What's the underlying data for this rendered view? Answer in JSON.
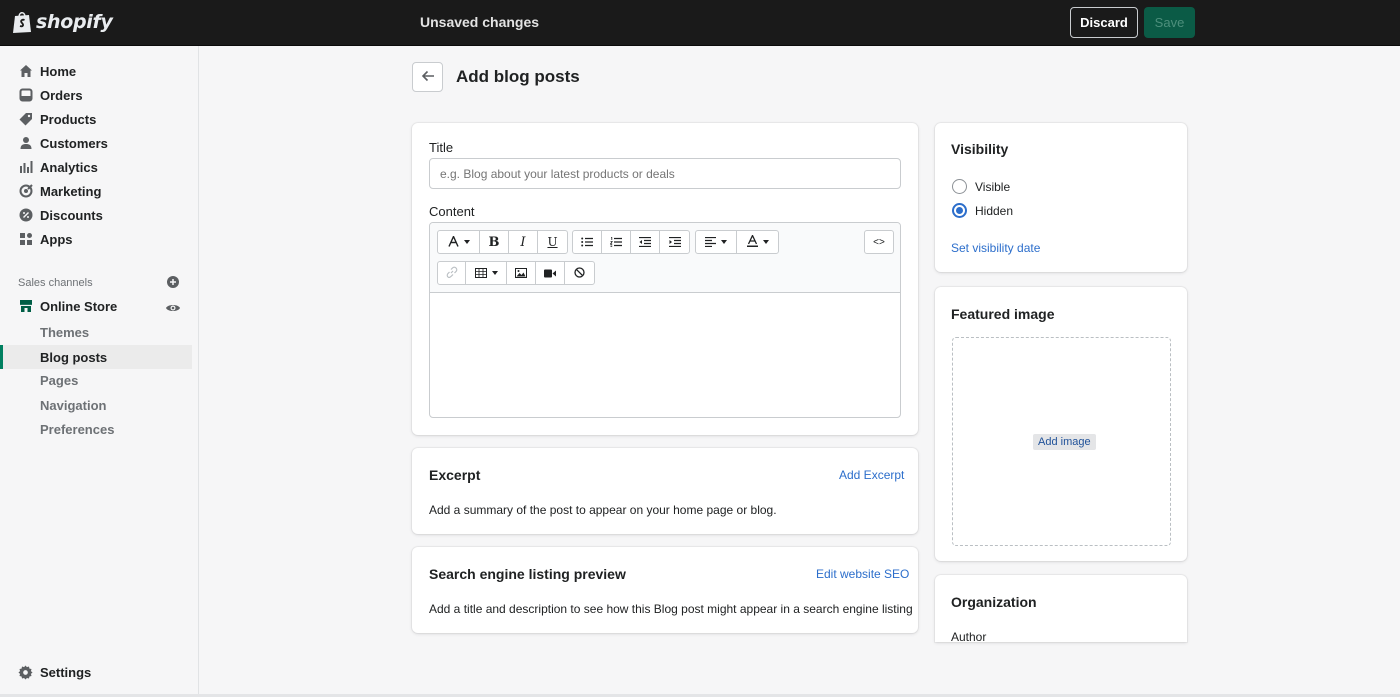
{
  "topbar": {
    "logo_text": "shopify",
    "status": "Unsaved changes",
    "discard_label": "Discard",
    "save_label": "Save"
  },
  "sidebar": {
    "items": [
      {
        "label": "Home",
        "icon": "home-icon"
      },
      {
        "label": "Orders",
        "icon": "orders-icon"
      },
      {
        "label": "Products",
        "icon": "tag-icon"
      },
      {
        "label": "Customers",
        "icon": "person-icon"
      },
      {
        "label": "Analytics",
        "icon": "bar-chart-icon"
      },
      {
        "label": "Marketing",
        "icon": "target-icon"
      },
      {
        "label": "Discounts",
        "icon": "discount-icon"
      },
      {
        "label": "Apps",
        "icon": "apps-icon"
      }
    ],
    "sales_channels_label": "Sales channels",
    "online_store_label": "Online Store",
    "sub_items": [
      "Themes",
      "Blog posts",
      "Pages",
      "Navigation",
      "Preferences"
    ],
    "active_sub_item": "Blog posts",
    "settings_label": "Settings"
  },
  "page": {
    "title": "Add blog posts"
  },
  "post_form": {
    "title_label": "Title",
    "title_placeholder": "e.g. Blog about your latest products or deals",
    "content_label": "Content",
    "html_toggle": "<>"
  },
  "excerpt": {
    "heading": "Excerpt",
    "action": "Add Excerpt",
    "description": "Add a summary of the post to appear on your home page or blog."
  },
  "seo": {
    "heading": "Search engine listing preview",
    "action": "Edit website SEO",
    "description": "Add a title and description to see how this Blog post might appear in a search engine listing"
  },
  "visibility": {
    "heading": "Visibility",
    "options": [
      "Visible",
      "Hidden"
    ],
    "selected": "Hidden",
    "action": "Set visibility date"
  },
  "featured_image": {
    "heading": "Featured image",
    "add_label": "Add image"
  },
  "organization": {
    "heading": "Organization",
    "author_label": "Author"
  },
  "colors": {
    "accent": "#008060",
    "link": "#2c6ecb",
    "topbar": "#1a1a1a"
  }
}
